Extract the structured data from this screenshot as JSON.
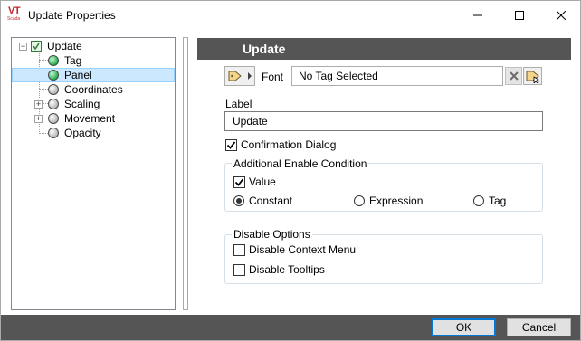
{
  "window": {
    "title": "Update Properties",
    "logo_text": "VT",
    "logo_subtext": "Scada"
  },
  "tree": {
    "root": {
      "label": "Update",
      "icon": "update-node-icon"
    },
    "items": [
      {
        "label": "Tag",
        "icon": "green-ball-icon",
        "selected": false
      },
      {
        "label": "Panel",
        "icon": "green-ball-icon",
        "selected": true
      },
      {
        "label": "Coordinates",
        "icon": "gray-ball-icon",
        "selected": false
      },
      {
        "label": "Scaling",
        "icon": "gray-ball-icon",
        "selected": false,
        "expandable": true
      },
      {
        "label": "Movement",
        "icon": "gray-ball-icon",
        "selected": false,
        "expandable": true
      },
      {
        "label": "Opacity",
        "icon": "gray-ball-icon",
        "selected": false
      }
    ]
  },
  "panel": {
    "header": "Update",
    "font": {
      "label": "Font",
      "value": "No Tag Selected"
    },
    "label_field": {
      "caption": "Label",
      "value": "Update"
    },
    "confirmation": {
      "label": "Confirmation Dialog",
      "checked": true
    },
    "enable_group": {
      "title": "Additional Enable Condition",
      "value": {
        "label": "Value",
        "checked": true
      },
      "options": [
        {
          "label": "Constant",
          "selected": true
        },
        {
          "label": "Expression",
          "selected": false
        },
        {
          "label": "Tag",
          "selected": false
        }
      ]
    },
    "disable_group": {
      "title": "Disable Options",
      "context_menu": {
        "label": "Disable Context Menu",
        "checked": false
      },
      "tooltips": {
        "label": "Disable Tooltips",
        "checked": false
      }
    }
  },
  "buttons": {
    "ok": "OK",
    "cancel": "Cancel"
  },
  "colors": {
    "header_bg": "#555555",
    "selection": "#cce8ff",
    "accent": "#0078d7",
    "logo": "#c0262c"
  }
}
